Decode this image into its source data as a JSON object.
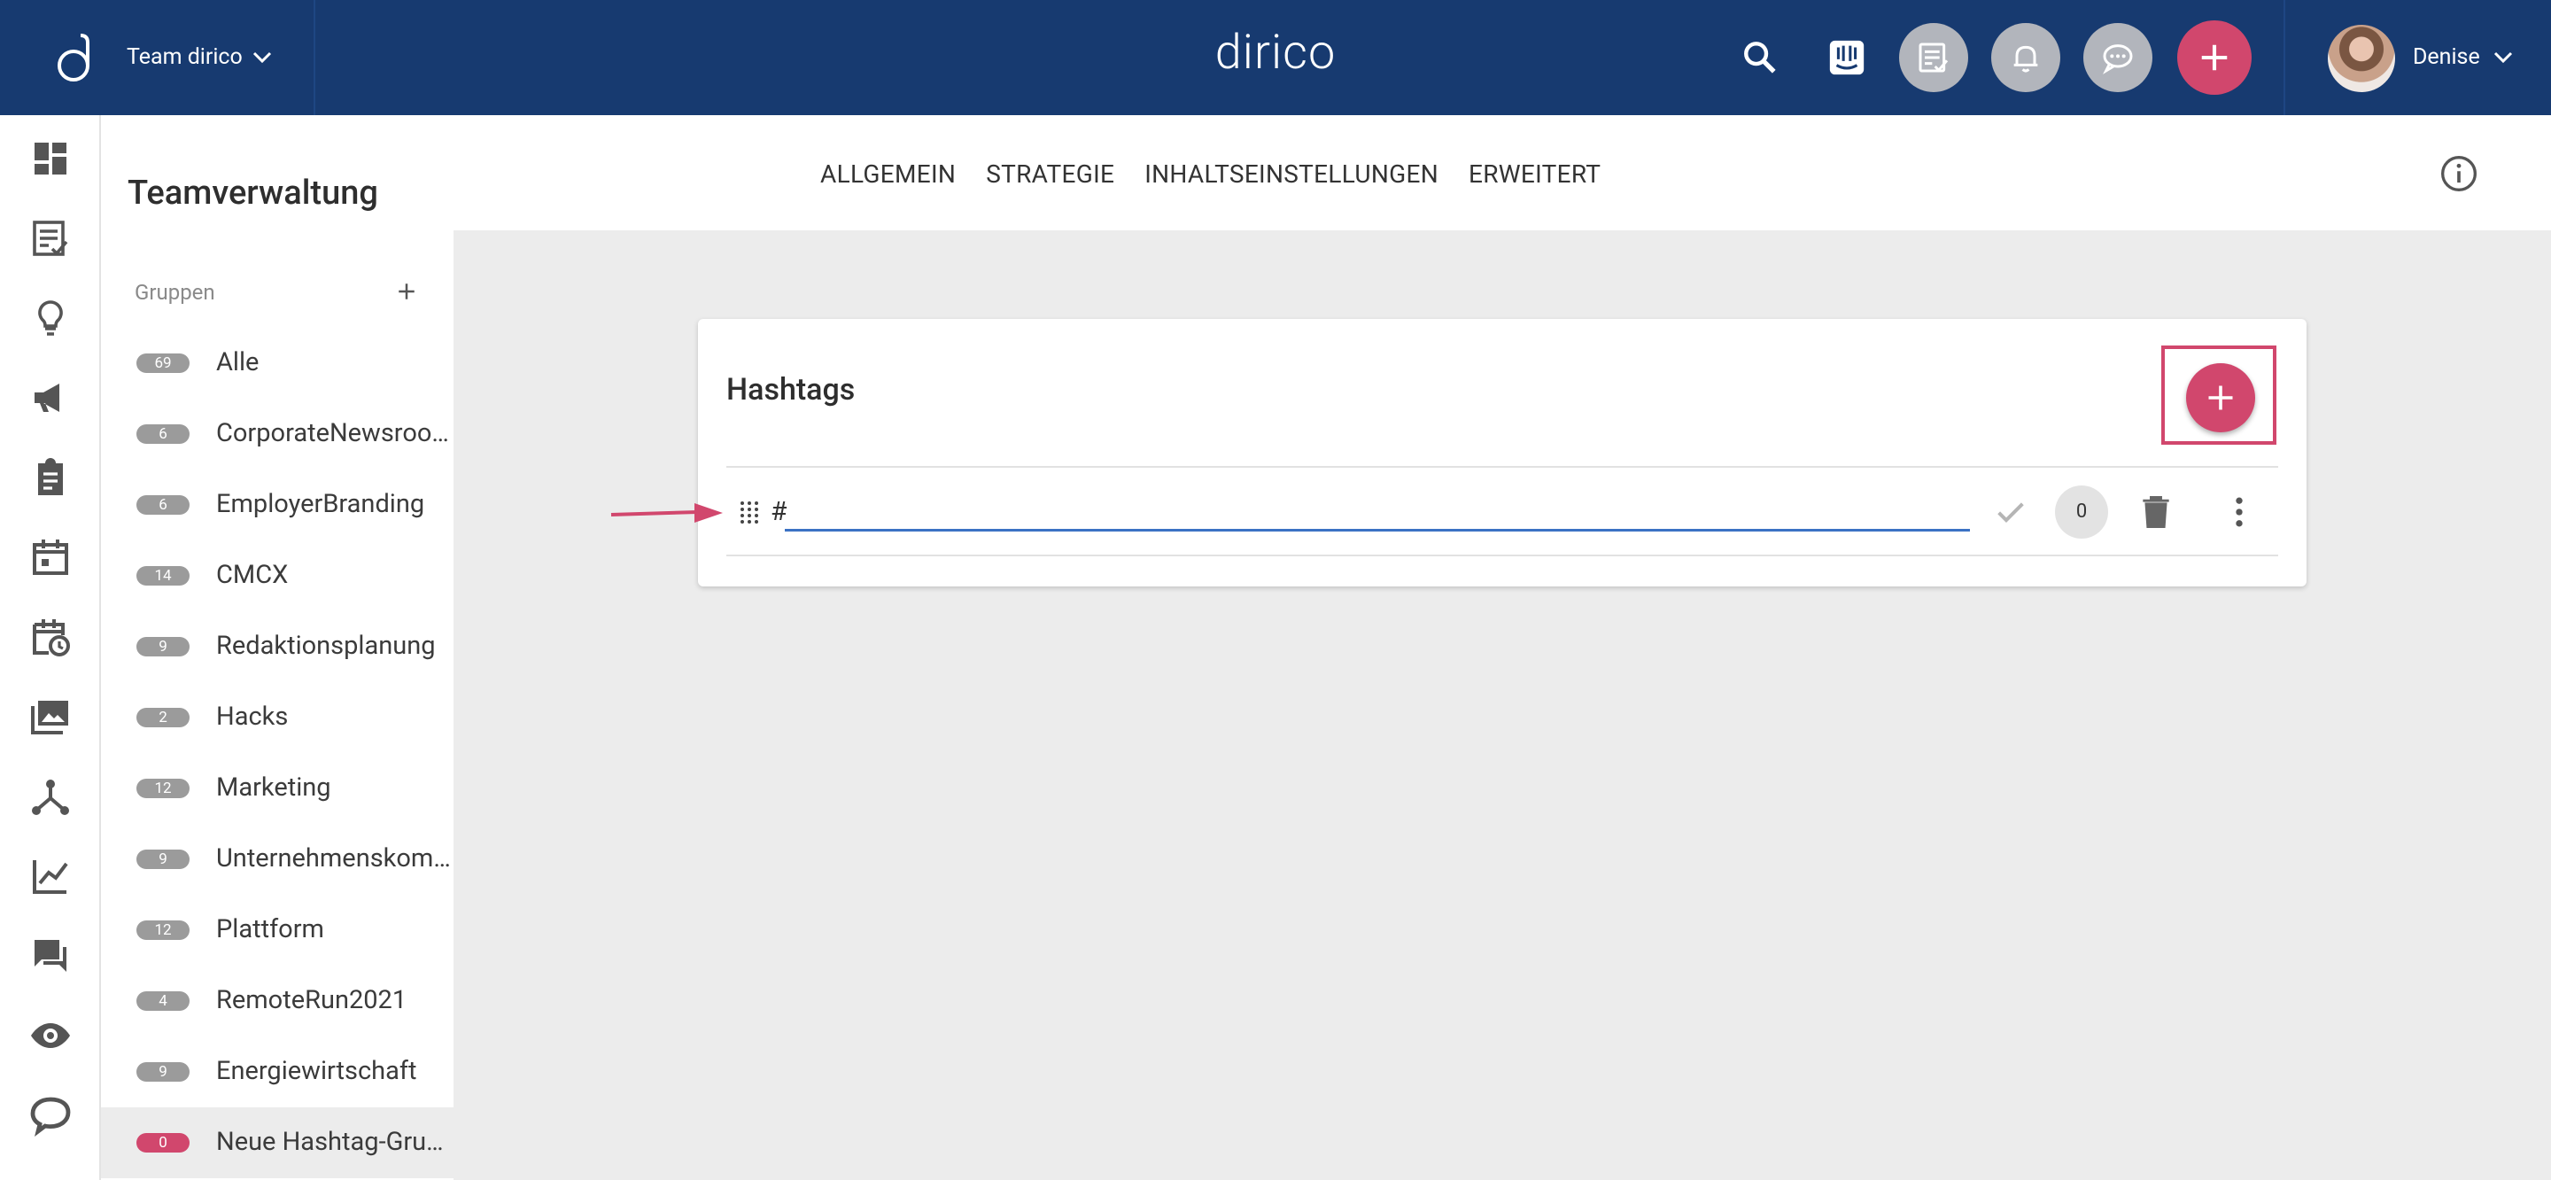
{
  "topbar": {
    "team_name": "Team dirico",
    "app_title": "dirico",
    "user_name": "Denise",
    "icons": [
      "search-icon",
      "intercom-icon",
      "tasks-icon",
      "bell-icon",
      "chat-icon",
      "plus-icon"
    ]
  },
  "page": {
    "title": "Teamverwaltung",
    "tabs": [
      "ALLGEMEIN",
      "STRATEGIE",
      "INHALTSEINSTELLUNGEN",
      "ERWEITERT"
    ]
  },
  "sidebar": {
    "groups_label": "Gruppen",
    "groups": [
      {
        "count": "69",
        "name": "Alle"
      },
      {
        "count": "6",
        "name": "CorporateNewsroom"
      },
      {
        "count": "6",
        "name": "EmployerBranding"
      },
      {
        "count": "14",
        "name": "CMCX"
      },
      {
        "count": "9",
        "name": "Redaktionsplanung"
      },
      {
        "count": "2",
        "name": "Hacks"
      },
      {
        "count": "12",
        "name": "Marketing"
      },
      {
        "count": "9",
        "name": "Unternehmenskom…"
      },
      {
        "count": "12",
        "name": "Plattform"
      },
      {
        "count": "4",
        "name": "RemoteRun2021"
      },
      {
        "count": "9",
        "name": "Energiewirtschaft"
      },
      {
        "count": "0",
        "name": "Neue Hashtag-Grup…"
      }
    ]
  },
  "card": {
    "title": "Hashtags",
    "hash_symbol": "#",
    "input_value": "",
    "usage_count": "0"
  },
  "colors": {
    "topbar": "#173a70",
    "accent": "#d1476d",
    "input_underline": "#3b72c4"
  }
}
